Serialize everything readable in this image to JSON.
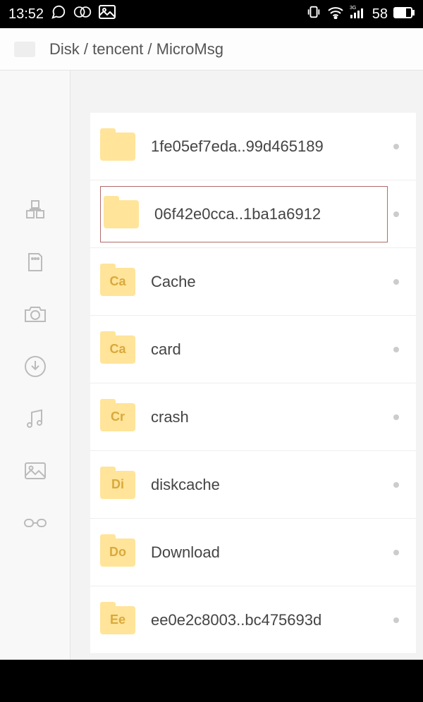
{
  "status": {
    "time": "13:52",
    "battery": "58"
  },
  "breadcrumb": {
    "path": "Disk / tencent / MicroMsg"
  },
  "sidebar": {
    "icons": [
      "category",
      "sd",
      "camera",
      "download",
      "music",
      "picture",
      "glasses"
    ]
  },
  "files": [
    {
      "name": "1fe05ef7eda..99d465189",
      "tag": "",
      "selected": false
    },
    {
      "name": "06f42e0cca..1ba1a6912",
      "tag": "",
      "selected": true
    },
    {
      "name": "Cache",
      "tag": "Ca",
      "selected": false
    },
    {
      "name": "card",
      "tag": "Ca",
      "selected": false
    },
    {
      "name": "crash",
      "tag": "Cr",
      "selected": false
    },
    {
      "name": "diskcache",
      "tag": "Di",
      "selected": false
    },
    {
      "name": "Download",
      "tag": "Do",
      "selected": false
    },
    {
      "name": "ee0e2c8003..bc475693d",
      "tag": "Ee",
      "selected": false
    }
  ]
}
